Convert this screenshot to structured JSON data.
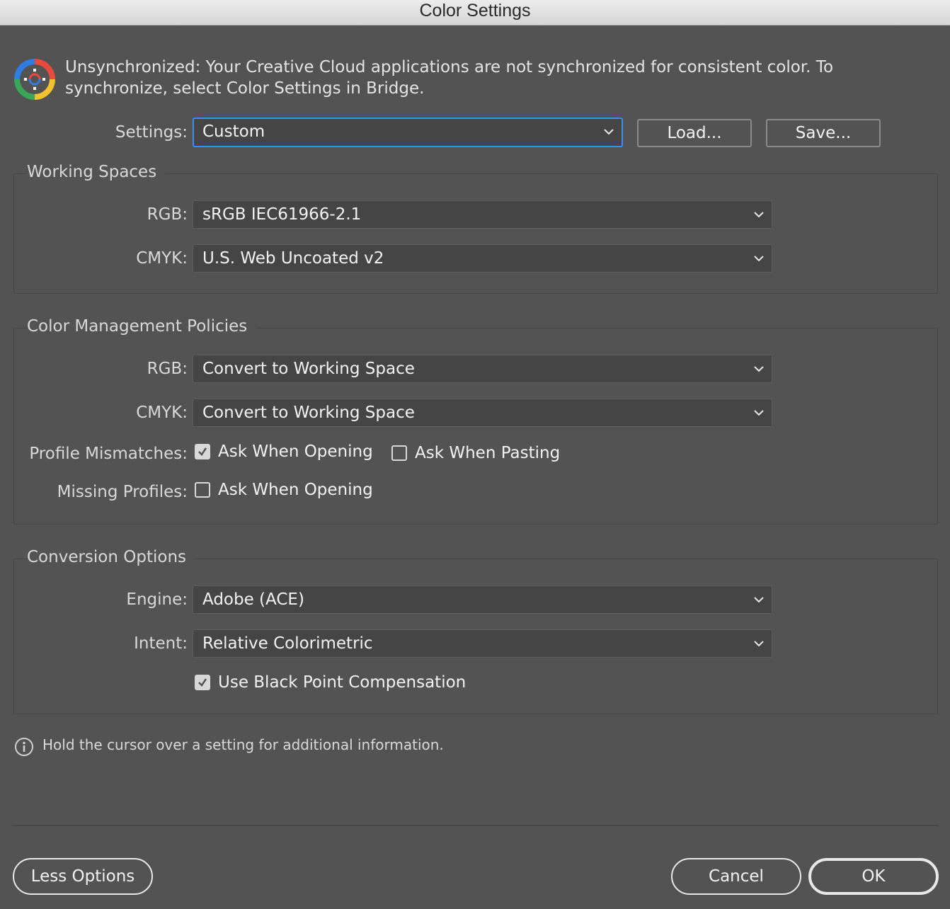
{
  "window": {
    "title": "Color Settings"
  },
  "sync": {
    "icon": "color-sync-icon",
    "message": "Unsynchronized: Your Creative Cloud applications are not synchronized for consistent color. To synchronize, select Color Settings in Bridge."
  },
  "settings": {
    "label": "Settings:",
    "value": "Custom"
  },
  "buttons": {
    "load": "Load...",
    "save": "Save...",
    "less_options": "Less Options",
    "cancel": "Cancel",
    "ok": "OK"
  },
  "working_spaces": {
    "title": "Working Spaces",
    "rgb": {
      "label": "RGB:",
      "value": "sRGB IEC61966-2.1"
    },
    "cmyk": {
      "label": "CMYK:",
      "value": "U.S. Web Uncoated v2"
    }
  },
  "policies": {
    "title": "Color Management Policies",
    "rgb": {
      "label": "RGB:",
      "value": "Convert to Working Space"
    },
    "cmyk": {
      "label": "CMYK:",
      "value": "Convert to Working Space"
    },
    "profile_mismatches": {
      "label": "Profile Mismatches:",
      "ask_opening": {
        "label": "Ask When Opening",
        "checked": true
      },
      "ask_pasting": {
        "label": "Ask When Pasting",
        "checked": false
      }
    },
    "missing_profiles": {
      "label": "Missing Profiles:",
      "ask_opening": {
        "label": "Ask When Opening",
        "checked": false
      }
    }
  },
  "conversion": {
    "title": "Conversion Options",
    "engine": {
      "label": "Engine:",
      "value": "Adobe (ACE)"
    },
    "intent": {
      "label": "Intent:",
      "value": "Relative Colorimetric"
    },
    "black_point": {
      "label": "Use Black Point Compensation",
      "checked": true
    }
  },
  "info": {
    "icon": "info-icon",
    "text": "Hold the cursor over a setting for additional information."
  },
  "colors": {
    "background": "#535353",
    "focus": "#3e8ee8",
    "titlebar": "#e0e0e0"
  }
}
